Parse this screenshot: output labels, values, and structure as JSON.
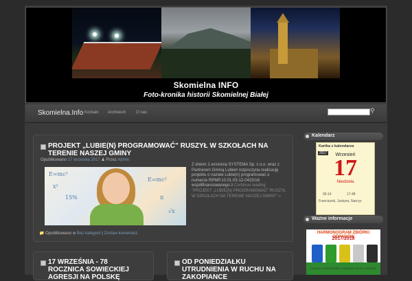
{
  "header": {
    "title": "Skomielna INFO",
    "subtitle": "Foto-kronika historii Skomielnej Białej"
  },
  "nav": {
    "brand": "Skomielna.Info",
    "links": [
      "Kontakt",
      "Archiwum",
      "O nas"
    ],
    "search_placeholder": ""
  },
  "posts": [
    {
      "title": "PROJEKT „LUBIE(N) PROGRAMOWAĆ” RUSZYŁ W SZKOŁACH NA TERENIE NASZEJ GMINY",
      "meta_prefix": "Opublikowano",
      "date": "17 września 2017",
      "by": "Przez",
      "author": "Admin",
      "excerpt": "Z dniem 1 września SYSTEMA Sp. z o.o. wraz z Partnerem Gminą Lubień rozpoczyna realizację projektu o nazwie Lubie(n) programować o numerze RPMP.10.01.03-12-0423/16 współfinansowanego z",
      "more": "Continue reading \"PROJEKT „LUBIE(N) PROGRAMOWAĆ” RUSZYŁ W SZKOŁACH NA TERENIE NASZEJ GMINY\" »",
      "footer_prefix": "Opublikowano w",
      "category": "Bez kategorii",
      "separator": "|",
      "comment": "Zostaw komentarz",
      "formulas": [
        "E=mc²",
        "π",
        "√x",
        "15%",
        "+",
        "×",
        "÷",
        "=",
        "x²"
      ]
    },
    {
      "title": "17 WRZEŚNIA - 78 ROCZNICA SOWIECKIEJ AGRESJI NA POLSKĘ"
    },
    {
      "title": "OD PONIEDZIAŁKU UTRUDNIENIA W RUCHU NA ZAKOPIANCE"
    }
  ],
  "sidebar": {
    "calendar_heading": "Kalendarz",
    "calendar": {
      "title": "Kartka z kalendarza",
      "year": "2017",
      "month": "Wrzesień",
      "day": "17",
      "weekday": "Niedziela",
      "sunrise": "06:14",
      "sunset": "17:48",
      "names": "Franciszek, Justyna, Narcyz"
    },
    "info_heading": "Ważne informacje",
    "banner": {
      "title": "HARMONOGRAM ZBIÓRKI ODPADÓW",
      "years": "2017/2018",
      "footer": "ZAKŁAD GOSPODARKI KOMUNALNEJ W LUBIENIU",
      "bin_colors": [
        "#1f5fc8",
        "#2d9c2d",
        "#d8c21a",
        "#c8c8c8",
        "#2d2d2d"
      ]
    }
  }
}
